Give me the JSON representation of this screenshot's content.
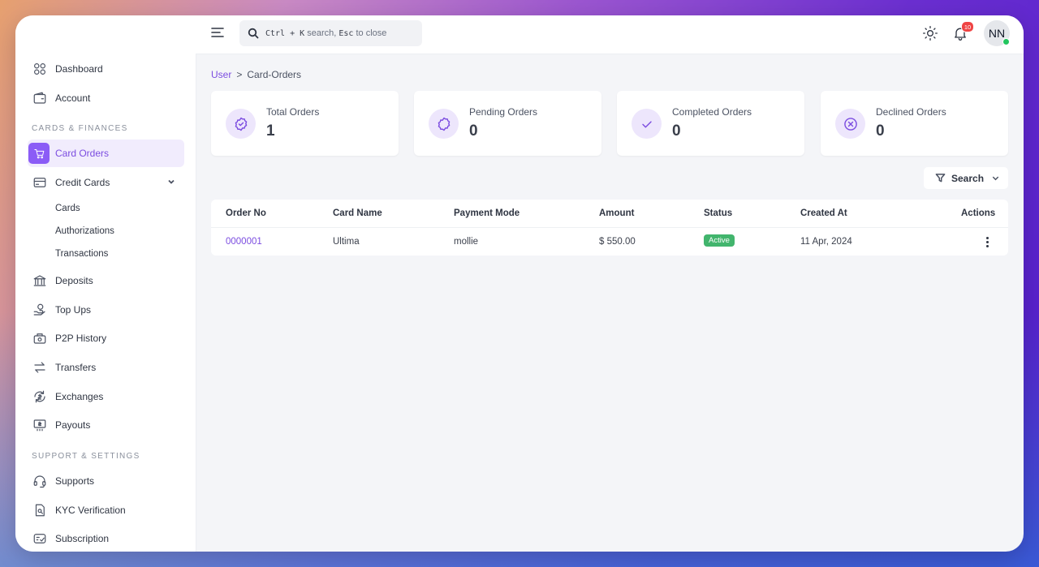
{
  "sidebar": {
    "items": [
      {
        "label": "Dashboard",
        "icon": "dashboard-icon"
      },
      {
        "label": "Account",
        "icon": "wallet-icon"
      }
    ],
    "sections": [
      {
        "label": "CARDS & FINANCES"
      },
      {
        "label": "SUPPORT & SETTINGS"
      }
    ],
    "card_orders": "Card Orders",
    "credit_cards": "Credit Cards",
    "credit_sub": [
      "Cards",
      "Authorizations",
      "Transactions"
    ],
    "finance_items": [
      "Deposits",
      "Top Ups",
      "P2P History",
      "Transfers",
      "Exchanges",
      "Payouts"
    ],
    "support_items": [
      "Supports",
      "KYC Verification",
      "Subscription"
    ]
  },
  "topbar": {
    "search_key1": "Ctrl + K",
    "search_mid": "search,",
    "search_key2": "Esc",
    "search_end": "to close",
    "notifications_count": "10",
    "avatar_initials": "NN"
  },
  "breadcrumb": {
    "parent": "User",
    "separator": ">",
    "current": "Card-Orders"
  },
  "stats": [
    {
      "label": "Total Orders",
      "value": "1",
      "icon": "badge-check-icon"
    },
    {
      "label": "Pending Orders",
      "value": "0",
      "icon": "badge-icon"
    },
    {
      "label": "Completed Orders",
      "value": "0",
      "icon": "check-icon"
    },
    {
      "label": "Declined Orders",
      "value": "0",
      "icon": "x-circle-icon"
    }
  ],
  "filter": {
    "label": "Search"
  },
  "table": {
    "headers": [
      "Order No",
      "Card Name",
      "Payment Mode",
      "Amount",
      "Status",
      "Created At",
      "Actions"
    ],
    "rows": [
      {
        "order_no": "0000001",
        "card_name": "Ultima",
        "payment_mode": "mollie",
        "amount": "$ 550.00",
        "status": "Active",
        "created_at": "11 Apr, 2024"
      }
    ]
  },
  "colors": {
    "accent": "#8b5cf6",
    "status_active": "#42b56d",
    "badge": "#ef4444"
  }
}
